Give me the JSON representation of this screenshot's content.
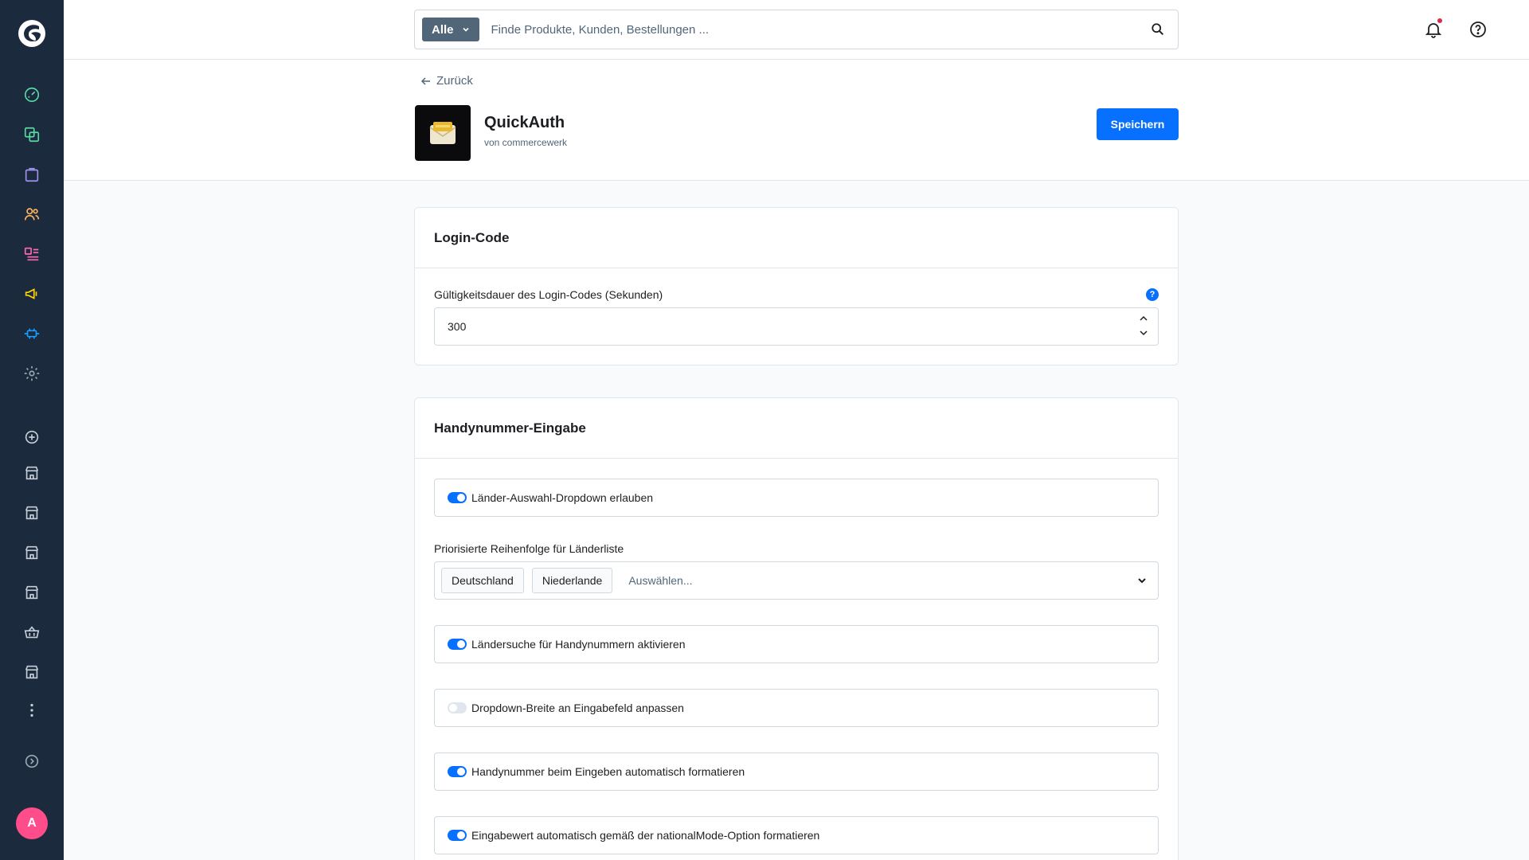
{
  "search": {
    "type_label": "Alle",
    "placeholder": "Finde Produkte, Kunden, Bestellungen ..."
  },
  "header": {
    "back_label": "Zurück",
    "app_title": "QuickAuth",
    "app_vendor": "von commercewerk",
    "save_label": "Speichern"
  },
  "sidebar": {
    "avatar_initial": "A"
  },
  "login_code": {
    "title": "Login-Code",
    "validity_label": "Gültigkeitsdauer des Login-Codes (Sekunden)",
    "validity_value": "300",
    "help": "?"
  },
  "phone_input": {
    "title": "Handynummer-Eingabe",
    "toggle_country_dropdown": "Länder-Auswahl-Dropdown erlauben",
    "priority_label": "Priorisierte Reihenfolge für Länderliste",
    "priority_selected": [
      "Deutschland",
      "Niederlande"
    ],
    "priority_placeholder": "Auswählen...",
    "toggle_country_search": "Ländersuche für Handynummern aktivieren",
    "toggle_dropdown_width": "Dropdown-Breite an Eingabefeld anpassen",
    "toggle_auto_format": "Handynummer beim Eingeben automatisch formatieren",
    "toggle_national_mode": "Eingabewert automatisch gemäß der nationalMode-Option formatieren"
  },
  "colors": {
    "sidebar_bg": "#1c2a3e",
    "accent": "#0870ff",
    "avatar": "#ff4d8b"
  }
}
